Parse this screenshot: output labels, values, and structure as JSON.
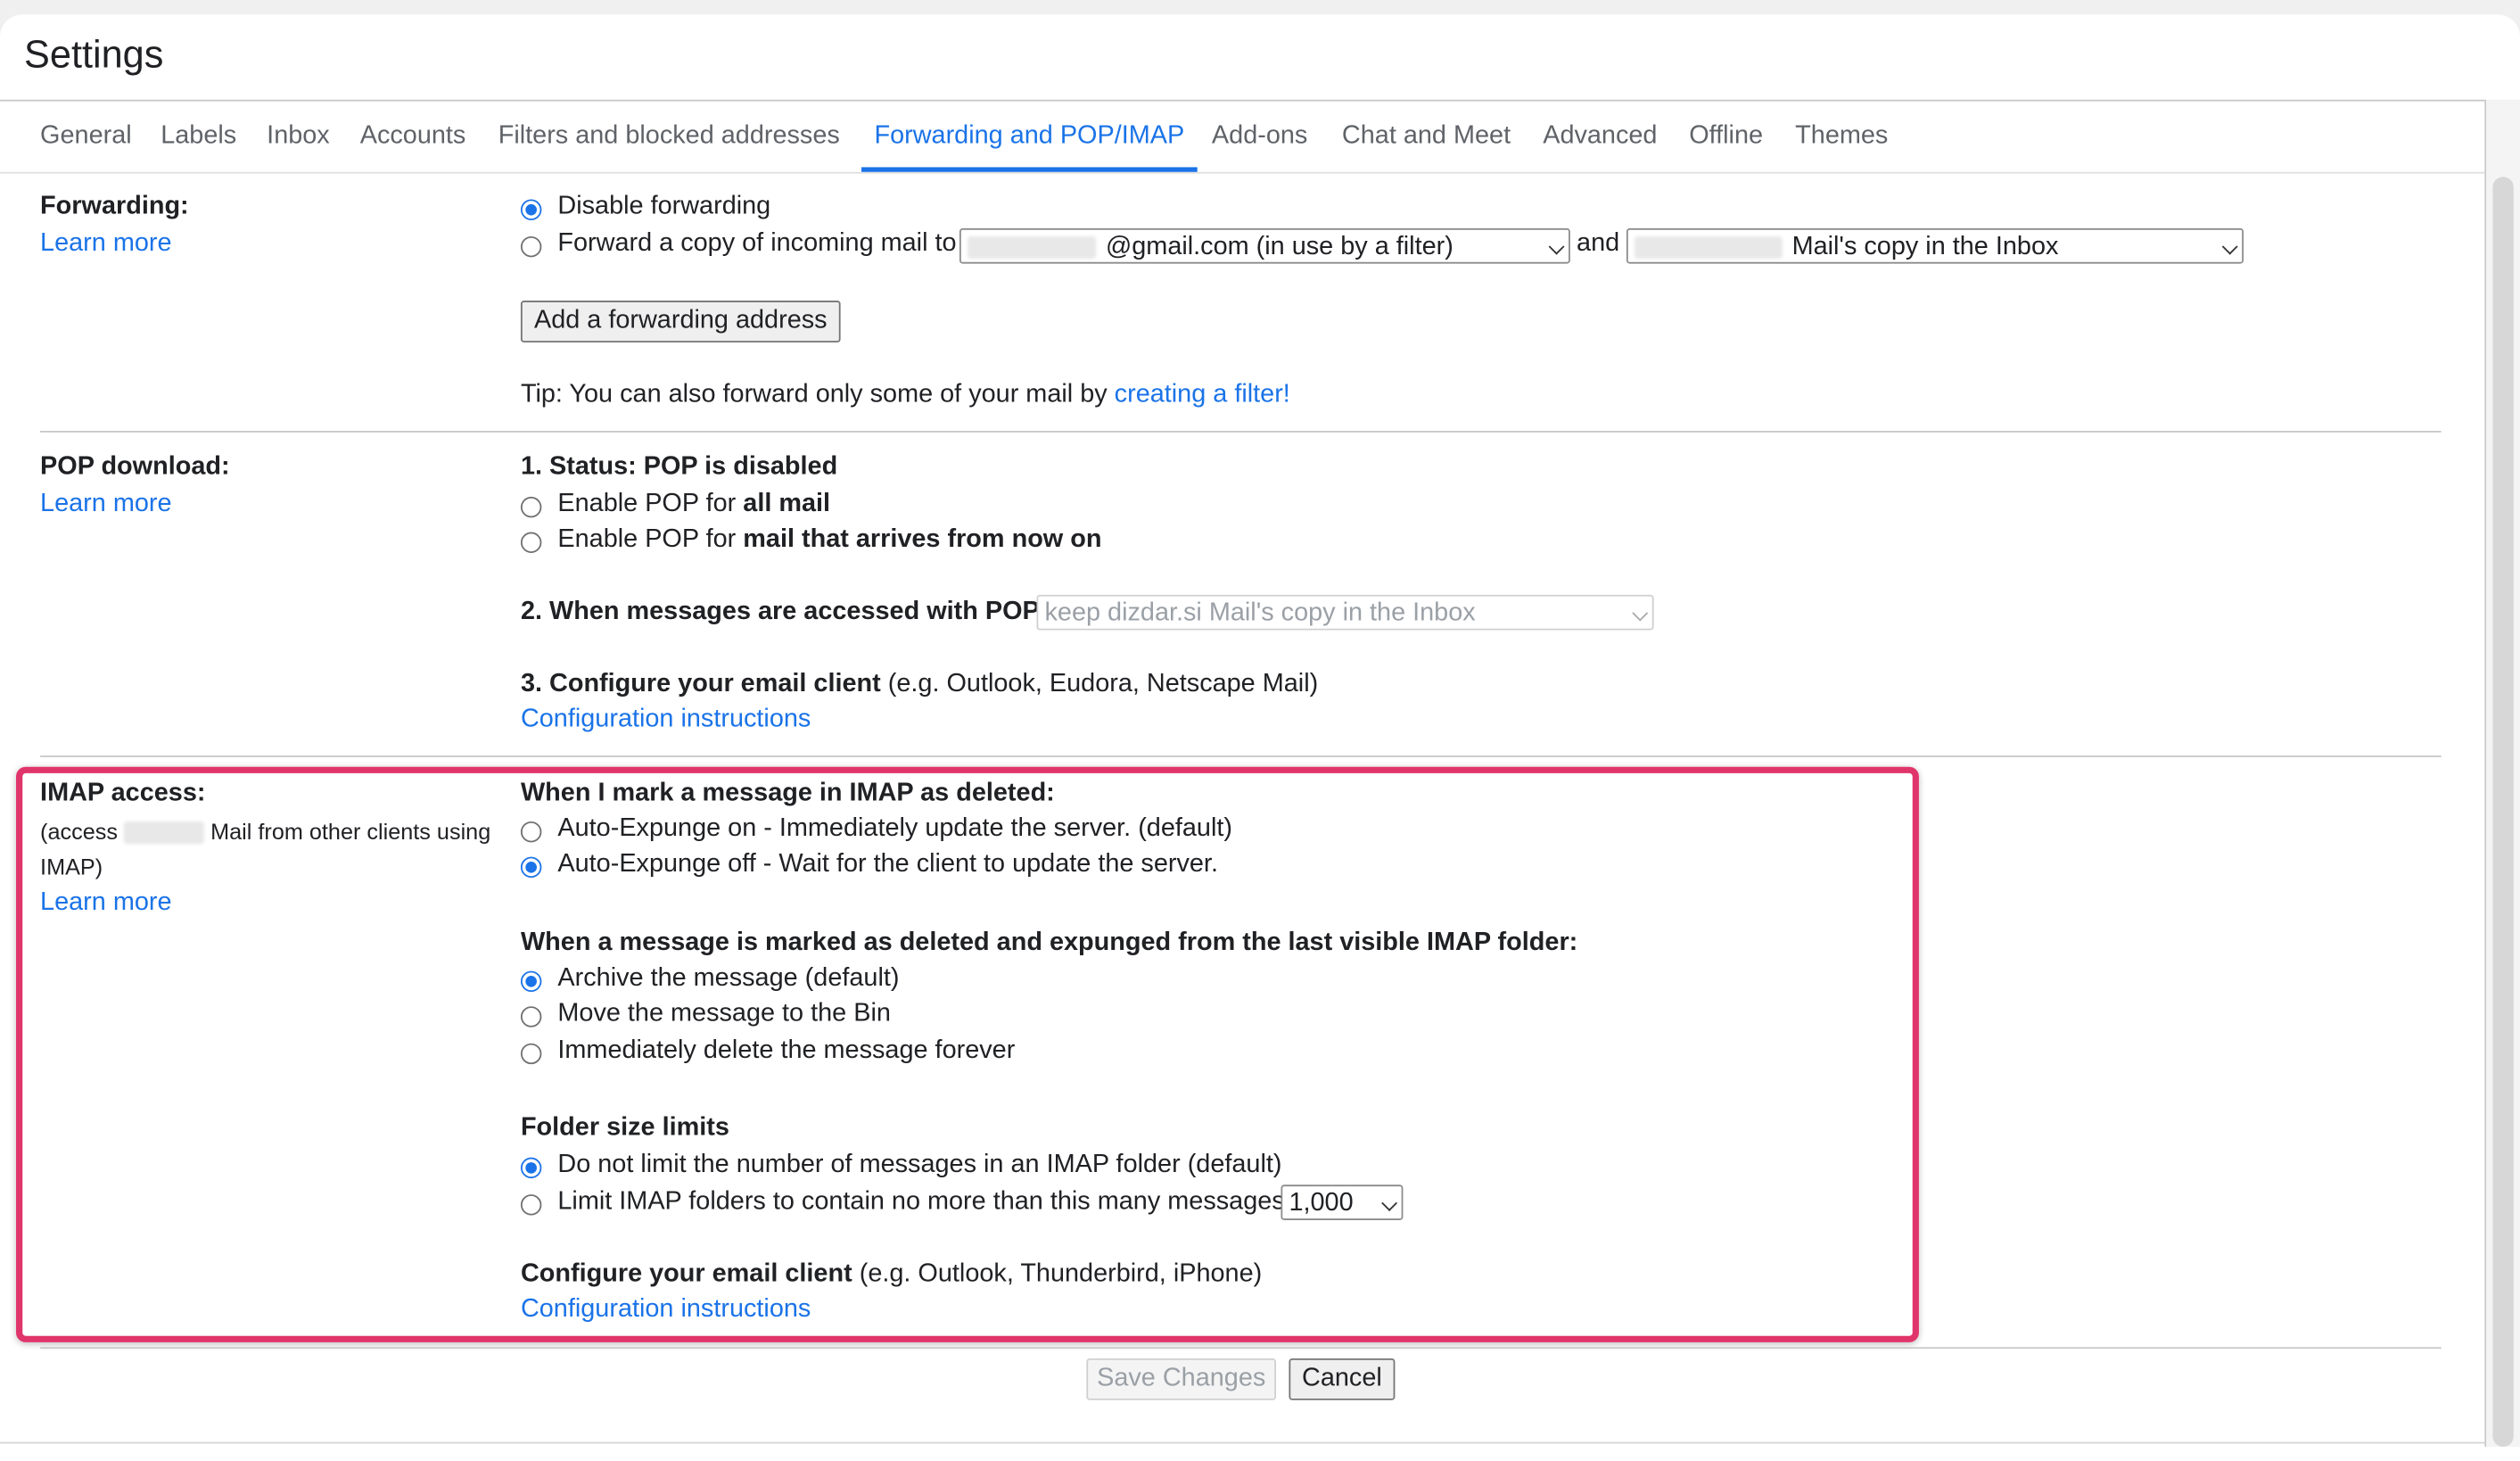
{
  "page": {
    "title": "Settings"
  },
  "tabs": [
    {
      "label": "General"
    },
    {
      "label": "Labels"
    },
    {
      "label": "Inbox"
    },
    {
      "label": "Accounts"
    },
    {
      "label": "Filters and blocked addresses"
    },
    {
      "label": "Forwarding and POP/IMAP",
      "active": true
    },
    {
      "label": "Add-ons"
    },
    {
      "label": "Chat and Meet"
    },
    {
      "label": "Advanced"
    },
    {
      "label": "Offline"
    },
    {
      "label": "Themes"
    }
  ],
  "forwarding": {
    "heading": "Forwarding:",
    "learn_more": "Learn more",
    "option_disable": "Disable forwarding",
    "option_forward": "Forward a copy of incoming mail to",
    "address_select": "@gmail.com (in use by a filter)",
    "and_text": "and",
    "action_select": "Mail's copy in the Inbox",
    "add_button": "Add a forwarding address",
    "tip_prefix": "Tip: You can also forward only some of your mail by",
    "tip_link": "creating a filter!",
    "selected": "Disable forwarding"
  },
  "pop": {
    "heading": "POP download:",
    "learn_more": "Learn more",
    "status": "1. Status: POP is disabled",
    "enable_all_prefix": "Enable POP for",
    "enable_all_bold": "all mail",
    "enable_new_prefix": "Enable POP for",
    "enable_new_bold": "mail that arrives from now on",
    "accessed_label": "2. When messages are accessed with POP",
    "accessed_select": "keep dizdar.si Mail's copy in the Inbox",
    "configure_bold": "3. Configure your email client",
    "configure_rest": "(e.g. Outlook, Eudora, Netscape Mail)",
    "config_link": "Configuration instructions"
  },
  "imap": {
    "heading": "IMAP access:",
    "desc_prefix": "(access",
    "desc_suffix": "Mail from other clients using",
    "desc_line2": "IMAP)",
    "learn_more": "Learn more",
    "deleted_heading": "When I mark a message in IMAP as deleted:",
    "expunge_on": "Auto-Expunge on - Immediately update the server. (default)",
    "expunge_off": "Auto-Expunge off - Wait for the client to update the server.",
    "expunge_selected": "Auto-Expunge off",
    "expunged_heading": "When a message is marked as deleted and expunged from the last visible IMAP folder:",
    "archive": "Archive the message (default)",
    "move_bin": "Move the message to the Bin",
    "delete_forever": "Immediately delete the message forever",
    "expunged_selected": "Archive the message (default)",
    "folder_heading": "Folder size limits",
    "no_limit": "Do not limit the number of messages in an IMAP folder (default)",
    "limit": "Limit IMAP folders to contain no more than this many messages",
    "limit_value": "1,000",
    "folder_selected": "Do not limit",
    "configure_bold": "Configure your email client",
    "configure_rest": "(e.g. Outlook, Thunderbird, iPhone)",
    "config_link": "Configuration instructions"
  },
  "footer": {
    "save": "Save Changes",
    "cancel": "Cancel"
  },
  "colors": {
    "accent": "#1a73e8",
    "highlight_border": "#e0356b"
  }
}
